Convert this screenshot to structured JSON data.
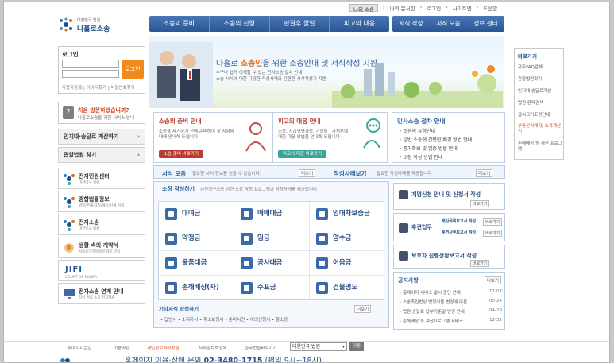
{
  "topnav": {
    "first": "나의 소송",
    "items": [
      "나의 문서함",
      "로그인",
      "사이트맵",
      "도움말"
    ]
  },
  "logo": {
    "line1": "대한민국 법원",
    "line2": "나홀로소송"
  },
  "mainnav": [
    "소송의 준비",
    "소송의 진행",
    "판결후 할일",
    "피고의 대응"
  ],
  "subnav": [
    "서식 작성",
    "서식 모음",
    "정보 센터"
  ],
  "login": {
    "title": "로그인",
    "button": "로그인",
    "links": "사용자등록 | 아이디찾기 | 비밀번호찾기"
  },
  "firstvisit": {
    "title": "처음 방문하셨습니까?",
    "sub": "나홀로소송을 위한 서비스 안내"
  },
  "leftbtns": [
    "인지대·송달료 계산하기",
    "관할법원 찾기"
  ],
  "banners": [
    {
      "title": "전자민원센터",
      "sub": "대한민국 법원"
    },
    {
      "title": "종합법률정보",
      "sub": "법령/판례/규칙/예규/선례 검색"
    },
    {
      "title": "전자소송",
      "sub": "대한민국 법원"
    },
    {
      "title": "생활 속의 계약서",
      "sub": "서울중앙지방법원 제공 양식"
    },
    {
      "title": "JIFI",
      "sub": "COURT OF KOREA"
    },
    {
      "title": "전자소송 연계 안내",
      "sub": "작성 완료 소장 전자제출"
    }
  ],
  "hero": {
    "head_pre": "나홀로 ",
    "head_hl": "소송인",
    "head_post": "을 위한 소송안내 및 서식작성 지원",
    "line1": "누구나 쉽게 이해할 수 있는 민사소송 절차 안내",
    "line2": "소송 서식에 대한 다양한 작성사례와 간편한 서식작성기 지원"
  },
  "rightcol": {
    "title": "바로가기",
    "items": [
      "자주FAQ검색",
      "관할법원찾기",
      "인지대·송달료계산",
      "법원·판례검색",
      "글씨크기조정안내",
      "부동산거래 및 소가계산기",
      "손해배상 등 계산 프로그램"
    ]
  },
  "info1": {
    "title": "소송의 준비 안내",
    "text1": "소송을 제기하기 전에 준비해야 할 사항에",
    "text2": "대해 안내해 드립니다",
    "button": "소송 준비 바로가기"
  },
  "info2": {
    "title": "피고의 대응 안내",
    "text1": "소장, 지급명령결정, 가압류 · 가처분에",
    "text2": "대한 대응 방법을 안내해 드립니다",
    "button": "피고의 대응 바로가기"
  },
  "info3": {
    "title": "민사소송 절차 안내",
    "items": [
      "소송의 유형안내",
      "일반 소송에 간편한 배경 방법 안내",
      "증거확보 및 입증 방법 안내",
      "소장 작성 방법 안내"
    ]
  },
  "bar": {
    "t1": "서식 모음",
    "d1": "필요한 서식 정보를 얻을 수 있습니다.",
    "more1": "더보기",
    "t2": "작성사례보기",
    "d2": "필요한 작성사례를 제공합니다.",
    "more2": "더보기"
  },
  "doc": {
    "title": "소장 작성하기",
    "desc": "금전청구소송 관련 소장 작성 프로그램과 작성사례를 제공합니다.",
    "cells": [
      "대여금",
      "매매대금",
      "임대차보증금",
      "약정금",
      "임금",
      "양수금",
      "물품대금",
      "공사대금",
      "어음금",
      "손해배상(자)",
      "수표금",
      "건물명도"
    ],
    "etc": "기타서식 작성하기",
    "etcmore": "더보기",
    "links": "• 답변서   • 소취하서   • 주소보정서   • 준비서면   • 이의신청서   • 항소장"
  },
  "rboxes": [
    {
      "title": "개명신청 안내 및 신청서 작성",
      "btn": "바로가기"
    },
    {
      "title": "후견업무",
      "s1": "재산목록보고서 작성",
      "s2": "후견사무보고서 작성",
      "btn1": "바로가기",
      "btn2": "바로가기"
    },
    {
      "title": "보호자 집행상황보고서 작성",
      "btn": "바로가기"
    }
  ],
  "notice": {
    "title": "공지사항",
    "more": "더보기",
    "rows": [
      {
        "t": "홈페이지 서비스 일시 중단 안내",
        "d": "11-07"
      },
      {
        "t": "소송촉진법상 법정이율 변경에 따른",
        "d": "05-24"
      },
      {
        "t": "법원 송달료 납부기준일 변경 안내",
        "d": "04-29"
      },
      {
        "t": "손해배상 등 계산프로그램 서비스",
        "d": "12-31"
      }
    ]
  },
  "footer": {
    "links": [
      "찾아오시는길",
      "이용약관",
      "개인정보처리방침",
      "저작권보호정책",
      "한국법원바로가기"
    ],
    "select": "대한민국 법원",
    "go": "이동"
  },
  "contact": {
    "pre": "홈페이지 이용·장애 문의 ",
    "phone": "02-3480-1715",
    "post": " (평일 9시~18시)"
  },
  "colors": {
    "nav": "#2b5596",
    "accent": "#f18a1a",
    "red": "#d4461b",
    "teal": "#3aa39a",
    "darkred": "#b93a2e"
  }
}
